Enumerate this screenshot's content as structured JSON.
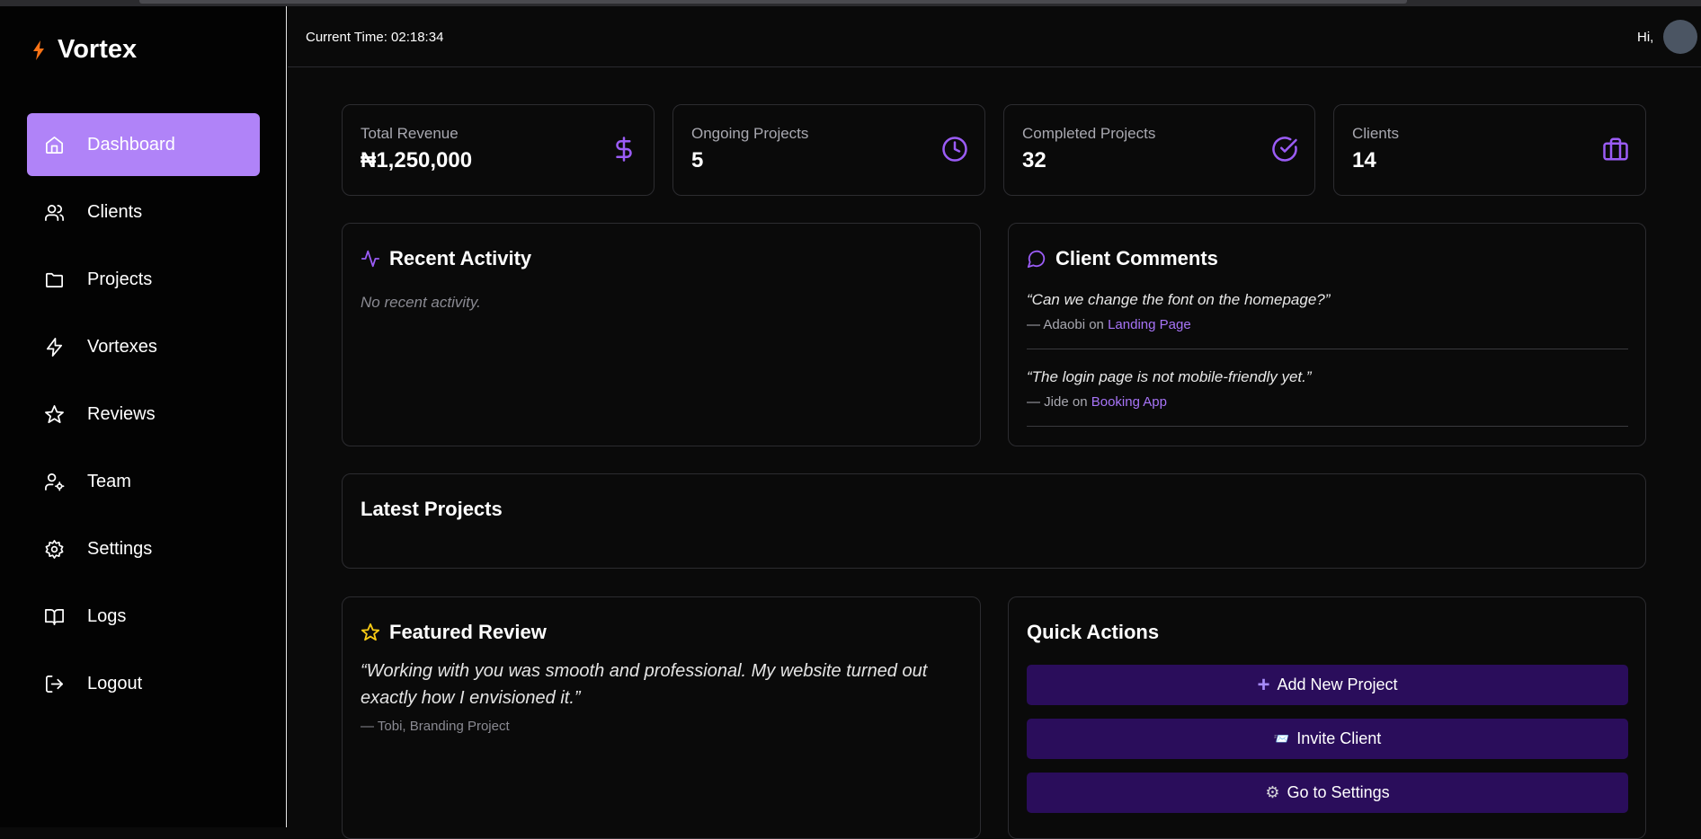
{
  "brand": {
    "name": "Vortex",
    "accent": "#b083f8",
    "bolt_color": "#f97316"
  },
  "sidebar": {
    "items": [
      {
        "label": "Dashboard",
        "icon": "home-icon",
        "active": true
      },
      {
        "label": "Clients",
        "icon": "users-icon"
      },
      {
        "label": "Projects",
        "icon": "folder-icon"
      },
      {
        "label": "Vortexes",
        "icon": "zap-icon"
      },
      {
        "label": "Reviews",
        "icon": "star-icon"
      },
      {
        "label": "Team",
        "icon": "user-cog-icon"
      },
      {
        "label": "Settings",
        "icon": "gear-icon"
      },
      {
        "label": "Logs",
        "icon": "book-icon"
      },
      {
        "label": "Logout",
        "icon": "logout-icon"
      }
    ]
  },
  "header": {
    "time_label": "Current Time: 02:18:34",
    "greeting": "Hi,"
  },
  "stats": [
    {
      "label": "Total Revenue",
      "value": "₦1,250,000",
      "icon": "dollar-icon"
    },
    {
      "label": "Ongoing Projects",
      "value": "5",
      "icon": "clock-icon"
    },
    {
      "label": "Completed Projects",
      "value": "32",
      "icon": "check-circle-icon"
    },
    {
      "label": "Clients",
      "value": "14",
      "icon": "briefcase-icon"
    }
  ],
  "recent_activity": {
    "title": "Recent Activity",
    "empty_text": "No recent activity."
  },
  "client_comments": {
    "title": "Client Comments",
    "items": [
      {
        "quote": "“Can we change the font on the homepage?”",
        "prefix": "— Adaobi on ",
        "project": "Landing Page"
      },
      {
        "quote": "“The login page is not mobile-friendly yet.”",
        "prefix": "— Jide on ",
        "project": "Booking App"
      }
    ]
  },
  "latest_projects": {
    "title": "Latest Projects"
  },
  "featured_review": {
    "title": "Featured Review",
    "text": "“Working with you was smooth and professional. My website turned out exactly how I envisioned it.”",
    "author": "— Tobi, Branding Project"
  },
  "quick_actions": {
    "title": "Quick Actions",
    "buttons": [
      {
        "label": "Add New Project",
        "glyph": "+",
        "icon": "plus-icon"
      },
      {
        "label": "Invite Client",
        "glyph": "📨",
        "icon": "envelope-icon"
      },
      {
        "label": "Go to Settings",
        "glyph": "⚙",
        "icon": "gear-icon"
      }
    ]
  }
}
